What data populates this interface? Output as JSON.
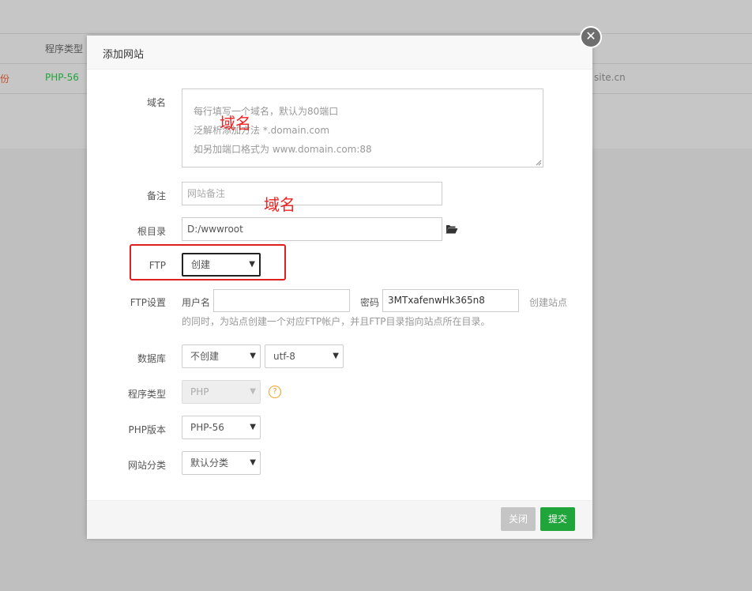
{
  "background": {
    "col_header": "程序类型",
    "row_left_text": "备份",
    "row_php": "PHP-56",
    "row_site": "site.cn"
  },
  "modal": {
    "title": "添加网站",
    "close_icon": "close-icon",
    "domain": {
      "label": "域名",
      "placeholder_lines": [
        "每行填写一个域名，默认为80端口",
        "泛解析添加方法 *.domain.com",
        "如另加端口格式为 www.domain.com:88"
      ]
    },
    "remark": {
      "label": "备注",
      "placeholder": "网站备注"
    },
    "root": {
      "label": "根目录",
      "value": "D:/wwwroot",
      "icon": "folder-open-icon"
    },
    "ftp": {
      "label": "FTP",
      "selected": "创建"
    },
    "ftp_settings": {
      "label": "FTP设置",
      "user_label": "用户名",
      "user_value": "",
      "pass_label": "密码",
      "pass_value": "3MTxafenwHk365n8",
      "hint_line1": "创建站点",
      "hint_line2": "的同时，为站点创建一个对应FTP帐户，并且FTP目录指向站点所在目录。"
    },
    "database": {
      "label": "数据库",
      "selected": "不创建",
      "charset": "utf-8"
    },
    "program_type": {
      "label": "程序类型",
      "selected": "PHP",
      "help": "?"
    },
    "php_version": {
      "label": "PHP版本",
      "selected": "PHP-56"
    },
    "site_category": {
      "label": "网站分类",
      "selected": "默认分类"
    },
    "buttons": {
      "close": "关闭",
      "submit": "提交"
    }
  },
  "annotations": [
    "域名",
    "域名"
  ],
  "colors": {
    "submit": "#20a53a",
    "close": "#c5c5c5",
    "annotation": "#e02020",
    "php_green": "#20a53a"
  }
}
